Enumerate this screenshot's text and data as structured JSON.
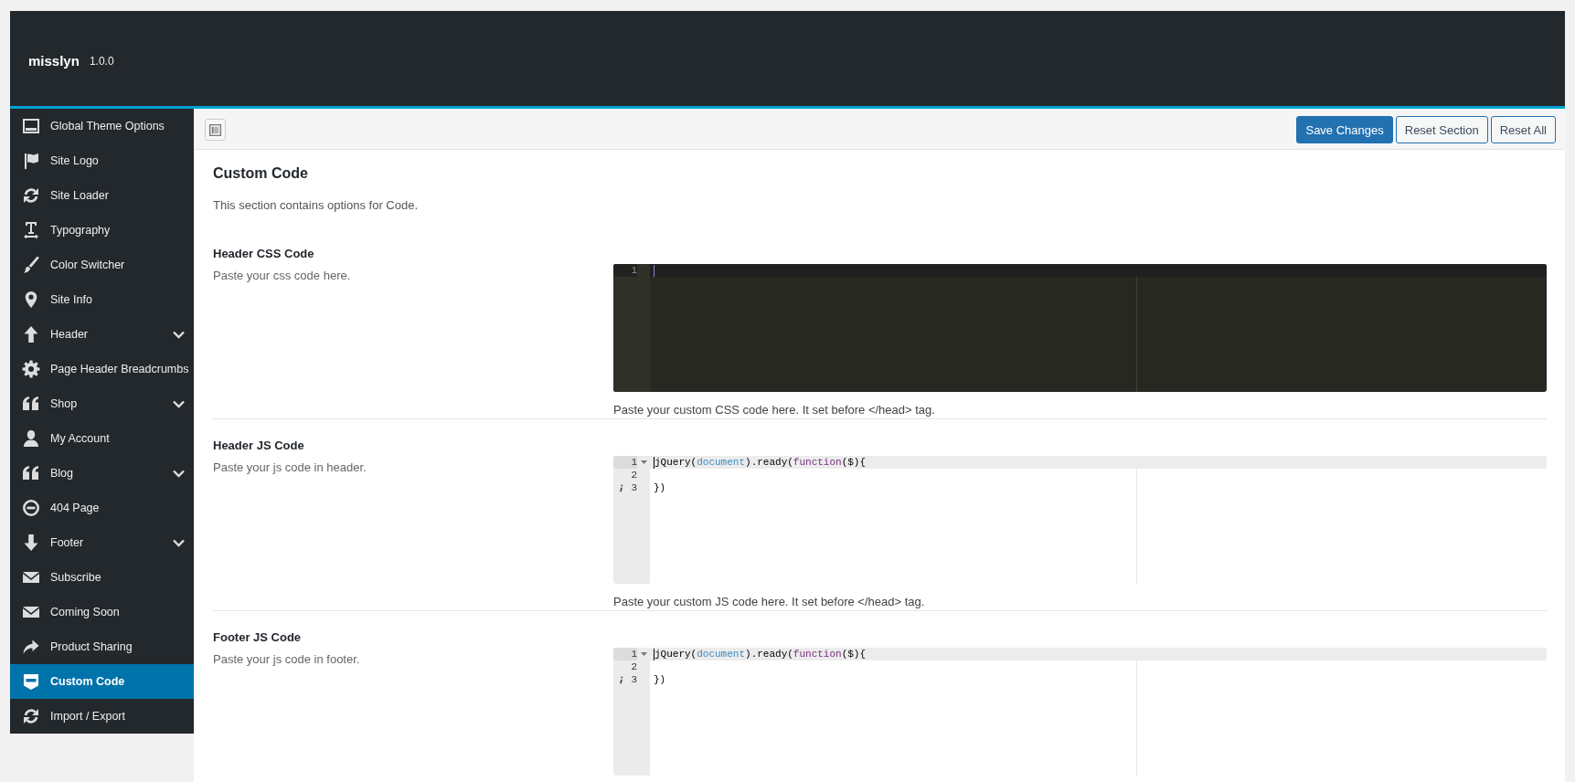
{
  "header": {
    "title": "misslyn",
    "version": "1.0.0"
  },
  "sidebar": {
    "items": [
      {
        "label": "Global Theme Options",
        "submenu": false,
        "selected": false
      },
      {
        "label": "Site Logo",
        "submenu": false,
        "selected": false
      },
      {
        "label": "Site Loader",
        "submenu": false,
        "selected": false
      },
      {
        "label": "Typography",
        "submenu": false,
        "selected": false
      },
      {
        "label": "Color Switcher",
        "submenu": false,
        "selected": false
      },
      {
        "label": "Site Info",
        "submenu": false,
        "selected": false
      },
      {
        "label": "Header",
        "submenu": true,
        "selected": false
      },
      {
        "label": "Page Header Breadcrumbs",
        "submenu": false,
        "selected": false
      },
      {
        "label": "Shop",
        "submenu": true,
        "selected": false
      },
      {
        "label": "My Account",
        "submenu": false,
        "selected": false
      },
      {
        "label": "Blog",
        "submenu": true,
        "selected": false
      },
      {
        "label": "404 Page",
        "submenu": false,
        "selected": false
      },
      {
        "label": "Footer",
        "submenu": true,
        "selected": false
      },
      {
        "label": "Subscribe",
        "submenu": false,
        "selected": false
      },
      {
        "label": "Coming Soon",
        "submenu": false,
        "selected": false
      },
      {
        "label": "Product Sharing",
        "submenu": false,
        "selected": false
      },
      {
        "label": "Custom Code",
        "submenu": false,
        "selected": true
      },
      {
        "label": "Import / Export",
        "submenu": false,
        "selected": false
      }
    ]
  },
  "toolbar": {
    "buttons": [
      {
        "label": "Save Changes",
        "kind": "primary"
      },
      {
        "label": "Reset Section",
        "kind": "secondary"
      },
      {
        "label": "Reset All",
        "kind": "secondary"
      }
    ]
  },
  "section": {
    "title": "Custom Code",
    "description": "This section contains options for Code.",
    "fields": [
      {
        "title": "Header CSS Code",
        "subtitle": "Paste your css code here.",
        "editor": {
          "kind": "dark",
          "lines": [
            {
              "number": "1",
              "active": true,
              "cursor": true,
              "fold": false,
              "info": false
            }
          ]
        },
        "description": "Paste your custom CSS code here. It set before </head> tag."
      },
      {
        "title": "Header JS Code",
        "subtitle": "Paste your js code in header.",
        "editor": {
          "kind": "light",
          "lines": [
            {
              "number": "1",
              "active": true,
              "cursor": true,
              "fold": true,
              "info": false,
              "tokens": [
                {
                  "text": "jQuery(",
                  "kind": "plain"
                },
                {
                  "text": "document",
                  "kind": "variable"
                },
                {
                  "text": ").ready(",
                  "kind": "plain"
                },
                {
                  "text": "function",
                  "kind": "keyword"
                },
                {
                  "text": "($){",
                  "kind": "plain"
                }
              ]
            },
            {
              "number": "2",
              "active": false,
              "cursor": false,
              "fold": false,
              "info": false
            },
            {
              "number": "3",
              "active": false,
              "cursor": false,
              "fold": false,
              "info": true,
              "tokens": [
                {
                  "text": "})",
                  "kind": "plain"
                }
              ]
            }
          ]
        },
        "description": "Paste your custom JS code here. It set before </head> tag."
      },
      {
        "title": "Footer JS Code",
        "subtitle": "Paste your js code in footer.",
        "editor": {
          "kind": "light",
          "lines": [
            {
              "number": "1",
              "active": true,
              "cursor": true,
              "fold": true,
              "info": false,
              "tokens": [
                {
                  "text": "jQuery(",
                  "kind": "plain"
                },
                {
                  "text": "document",
                  "kind": "variable"
                },
                {
                  "text": ").ready(",
                  "kind": "plain"
                },
                {
                  "text": "function",
                  "kind": "keyword"
                },
                {
                  "text": "($){",
                  "kind": "plain"
                }
              ]
            },
            {
              "number": "2",
              "active": false,
              "cursor": false,
              "fold": false,
              "info": false
            },
            {
              "number": "3",
              "active": false,
              "cursor": false,
              "fold": false,
              "info": true,
              "tokens": [
                {
                  "text": "})",
                  "kind": "plain"
                }
              ]
            }
          ]
        }
      }
    ]
  }
}
